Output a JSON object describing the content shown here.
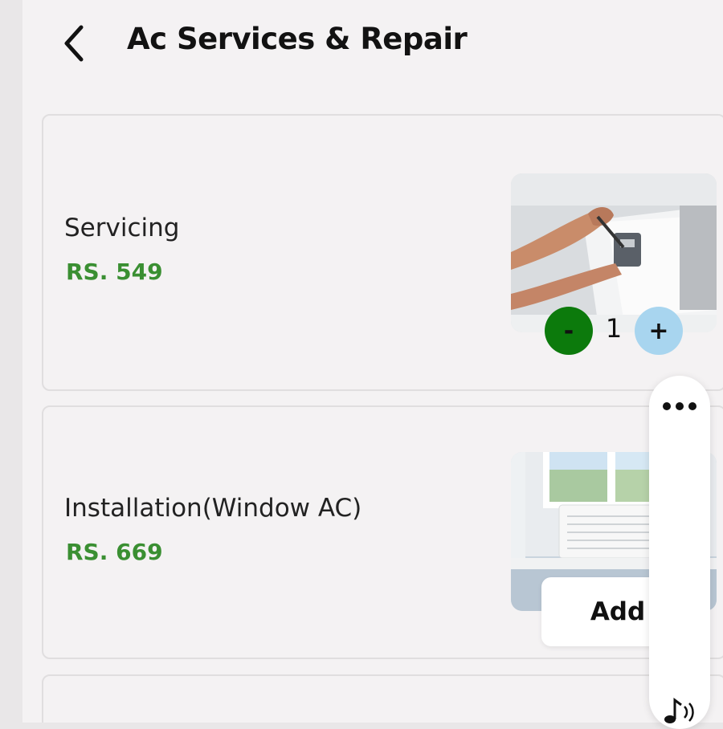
{
  "header": {
    "title": "Ac Services & Repair",
    "back_icon": "chevron-left-icon"
  },
  "services": [
    {
      "name": "Servicing",
      "price": "RS. 549",
      "quantity": "1",
      "qty_minus_label": "-",
      "qty_plus_label": "+"
    },
    {
      "name": "Installation(Window AC)",
      "price": "RS. 669",
      "add_label": "Add"
    }
  ],
  "floating_panel": {
    "more_icon": "more-horizontal-icon",
    "audio_icon": "music-sound-icon"
  },
  "colors": {
    "price_green": "#3a8f32",
    "minus_button": "#0c7a0c",
    "plus_button": "#a8d5ef",
    "background": "#f4f2f3"
  }
}
